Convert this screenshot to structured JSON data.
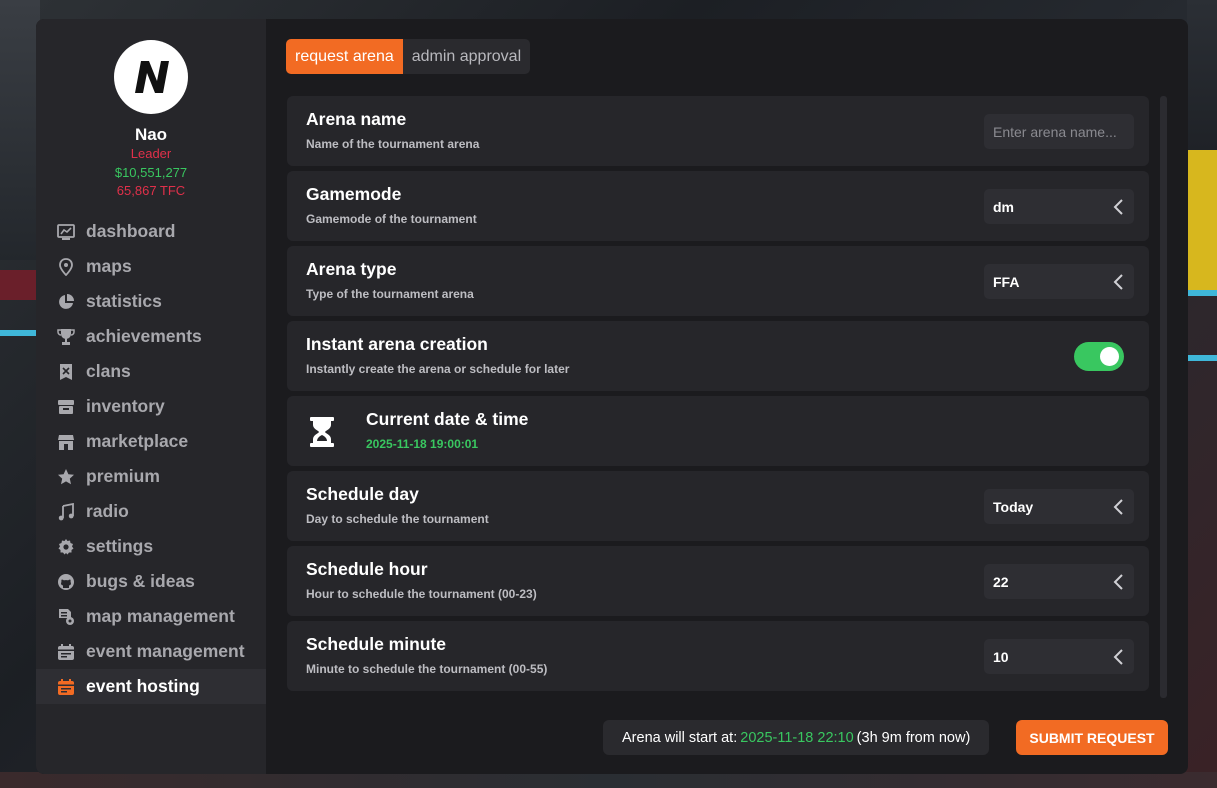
{
  "colors": {
    "accent": "#f26b23",
    "green": "#39c760",
    "red": "#e0304a"
  },
  "profile": {
    "name": "Nao",
    "role": "Leader",
    "money": "$10,551,277",
    "tfc": "65,867 TFC",
    "avatar_letter": "N"
  },
  "sidebar": {
    "items": [
      {
        "label": "dashboard",
        "icon": "chart-icon"
      },
      {
        "label": "maps",
        "icon": "map-pin-icon"
      },
      {
        "label": "statistics",
        "icon": "pie-chart-icon"
      },
      {
        "label": "achievements",
        "icon": "trophy-icon"
      },
      {
        "label": "clans",
        "icon": "shield-icon"
      },
      {
        "label": "inventory",
        "icon": "box-icon"
      },
      {
        "label": "marketplace",
        "icon": "store-icon"
      },
      {
        "label": "premium",
        "icon": "star-icon"
      },
      {
        "label": "radio",
        "icon": "music-icon"
      },
      {
        "label": "settings",
        "icon": "gear-icon"
      },
      {
        "label": "bugs & ideas",
        "icon": "github-icon"
      },
      {
        "label": "map management",
        "icon": "map-management-icon"
      },
      {
        "label": "event management",
        "icon": "calendar-icon"
      },
      {
        "label": "event hosting",
        "icon": "calendar-host-icon",
        "active": true
      }
    ]
  },
  "tabs": {
    "request": "request arena",
    "approval": "admin approval"
  },
  "form": {
    "arena_name": {
      "title": "Arena name",
      "desc": "Name of the tournament arena",
      "placeholder": "Enter arena name..."
    },
    "gamemode": {
      "title": "Gamemode",
      "desc": "Gamemode of the tournament",
      "value": "dm"
    },
    "arena_type": {
      "title": "Arena type",
      "desc": "Type of the tournament arena",
      "value": "FFA"
    },
    "instant": {
      "title": "Instant arena creation",
      "desc": "Instantly create the arena or schedule for later",
      "enabled": true
    },
    "datetime": {
      "title": "Current date & time",
      "value": "2025-11-18 19:00:01"
    },
    "schedule_day": {
      "title": "Schedule day",
      "desc": "Day to schedule the tournament",
      "value": "Today"
    },
    "schedule_hour": {
      "title": "Schedule hour",
      "desc": "Hour to schedule the tournament (00-23)",
      "value": "22"
    },
    "schedule_minute": {
      "title": "Schedule minute",
      "desc": "Minute to schedule the tournament (00-55)",
      "value": "10"
    }
  },
  "footer": {
    "start_label": "Arena will start at:",
    "start_time": "2025-11-18 22:10",
    "from_now": "(3h 9m from now)",
    "submit": "SUBMIT REQUEST"
  }
}
